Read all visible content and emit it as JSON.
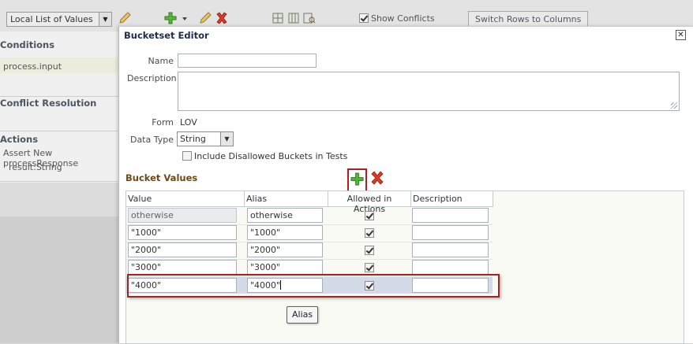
{
  "app": {
    "toolbar": {
      "list_select": "Local List of Values",
      "show_conflicts_label": "Show Conflicts",
      "show_conflicts_checked": true,
      "switch_button": "Switch Rows to Columns"
    },
    "left_panel": {
      "conditions_heading": "Conditions",
      "condition_item": "process.input",
      "conflict_heading": "Conflict Resolution",
      "actions_heading": "Actions",
      "action_item": "Assert New processResponse",
      "action_sub_item": "result:String"
    }
  },
  "dialog": {
    "title": "Bucketset Editor",
    "name_label": "Name",
    "name_value": "",
    "description_label": "Description",
    "description_value": "",
    "form_label": "Form",
    "form_value": "LOV",
    "datatype_label": "Data Type",
    "datatype_value": "String",
    "include_disallowed_label": "Include Disallowed Buckets in Tests",
    "include_disallowed_checked": false,
    "bucket_values_title": "Bucket Values",
    "columns": [
      "Value",
      "Alias",
      "Allowed in Actions",
      "Description"
    ],
    "rows": [
      {
        "value": "otherwise",
        "alias": "otherwise",
        "allowed": true,
        "description": ""
      },
      {
        "value": "\"1000\"",
        "alias": "\"1000\"",
        "allowed": true,
        "description": ""
      },
      {
        "value": "\"2000\"",
        "alias": "\"2000\"",
        "allowed": true,
        "description": ""
      },
      {
        "value": "\"3000\"",
        "alias": "\"3000\"",
        "allowed": true,
        "description": ""
      },
      {
        "value": "\"4000\"",
        "alias": "\"4000\"",
        "allowed": true,
        "description": ""
      }
    ],
    "tooltip": "Alias"
  }
}
